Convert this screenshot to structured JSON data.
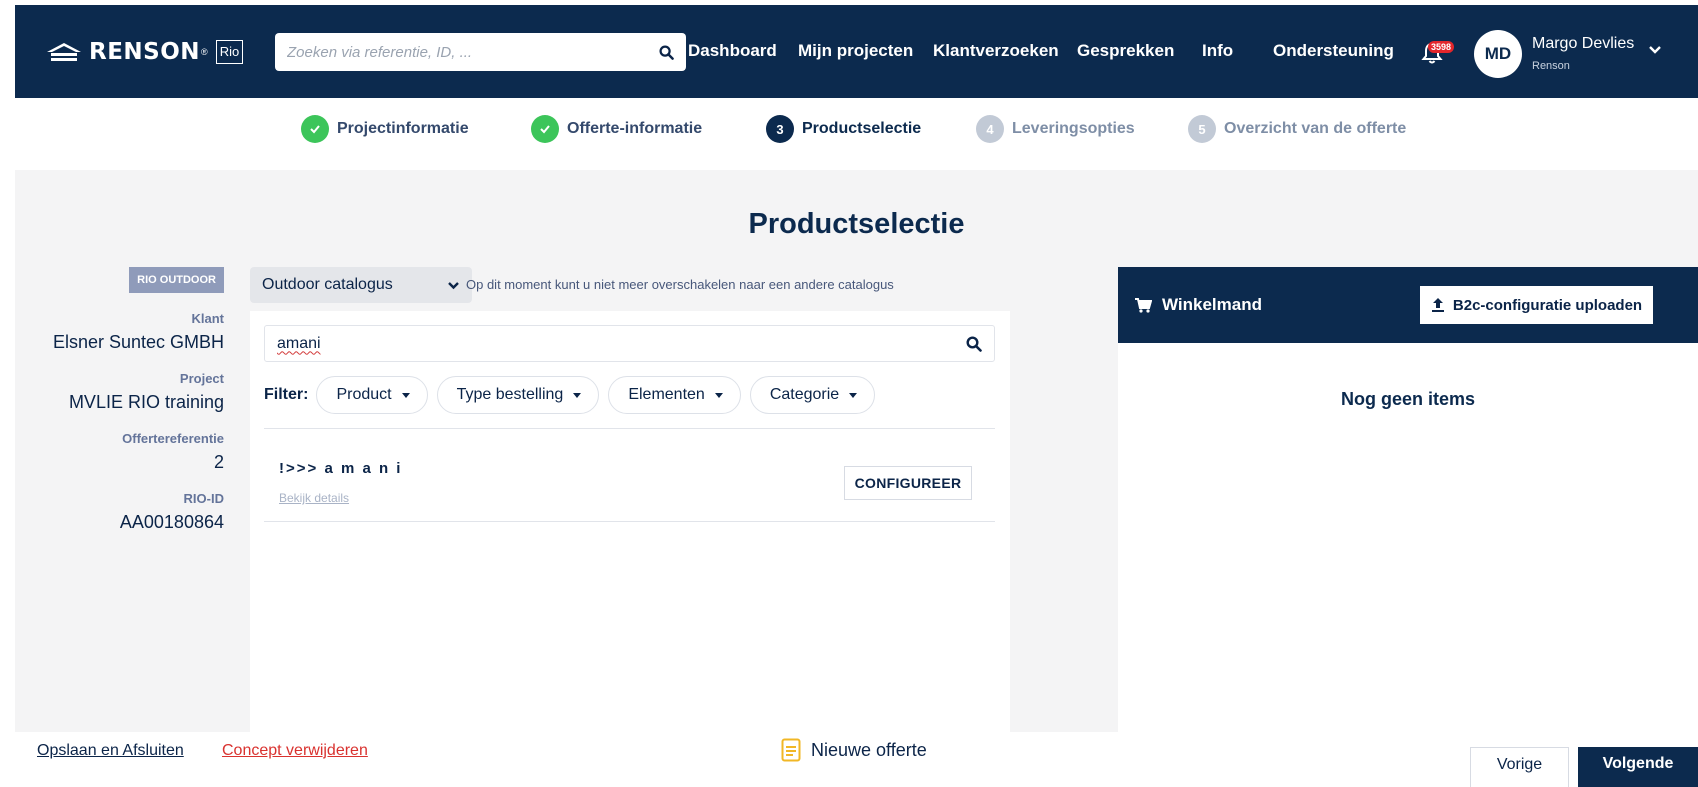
{
  "header": {
    "logo_text": "RENSON",
    "logo_sub": "Rio",
    "search_placeholder": "Zoeken via referentie, ID, ...",
    "nav": [
      "Dashboard",
      "Mijn projecten",
      "Klantverzoeken",
      "Gesprekken",
      "Info",
      "Ondersteuning"
    ],
    "notification_count": "3598",
    "user_initials": "MD",
    "user_name": "Margo Devlies",
    "user_org": "Renson"
  },
  "steps": [
    {
      "number": "",
      "label": "Projectinformatie",
      "state": "done"
    },
    {
      "number": "",
      "label": "Offerte-informatie",
      "state": "done"
    },
    {
      "number": "3",
      "label": "Productselectie",
      "state": "active"
    },
    {
      "number": "4",
      "label": "Leveringsopties",
      "state": "todo"
    },
    {
      "number": "5",
      "label": "Overzicht van de offerte",
      "state": "todo"
    }
  ],
  "page_title": "Productselectie",
  "sidebar": {
    "tag": "RIO OUTDOOR",
    "fields": [
      {
        "label": "Klant",
        "value": "Elsner Suntec GMBH"
      },
      {
        "label": "Project",
        "value": "MVLIE RIO training"
      },
      {
        "label": "Offertereferentie",
        "value": "2"
      },
      {
        "label": "RIO-ID",
        "value": "AA00180864"
      }
    ]
  },
  "catalog": {
    "selected": "Outdoor catalogus",
    "note": "Op dit moment kunt u niet meer overschakelen naar een andere catalogus"
  },
  "product_search": {
    "value": "amani"
  },
  "filters": {
    "label": "Filter:",
    "chips": [
      "Product",
      "Type bestelling",
      "Elementen",
      "Categorie"
    ]
  },
  "results": [
    {
      "title": "!>>> a m a n i",
      "details_link": "Bekijk details",
      "action": "CONFIGUREER"
    }
  ],
  "cart": {
    "title": "Winkelmand",
    "upload_label": "B2c-configuratie uploaden",
    "empty_text": "Nog geen items"
  },
  "footer": {
    "save_close": "Opslaan en Afsluiten",
    "delete_concept": "Concept verwijderen",
    "center_label": "Nieuwe offerte",
    "prev": "Vorige",
    "next": "Volgende"
  },
  "colors": {
    "navy": "#0c2a4e",
    "done_green": "#3cc55a",
    "danger_red": "#d9322f",
    "tag_grey": "#8f9bba"
  }
}
